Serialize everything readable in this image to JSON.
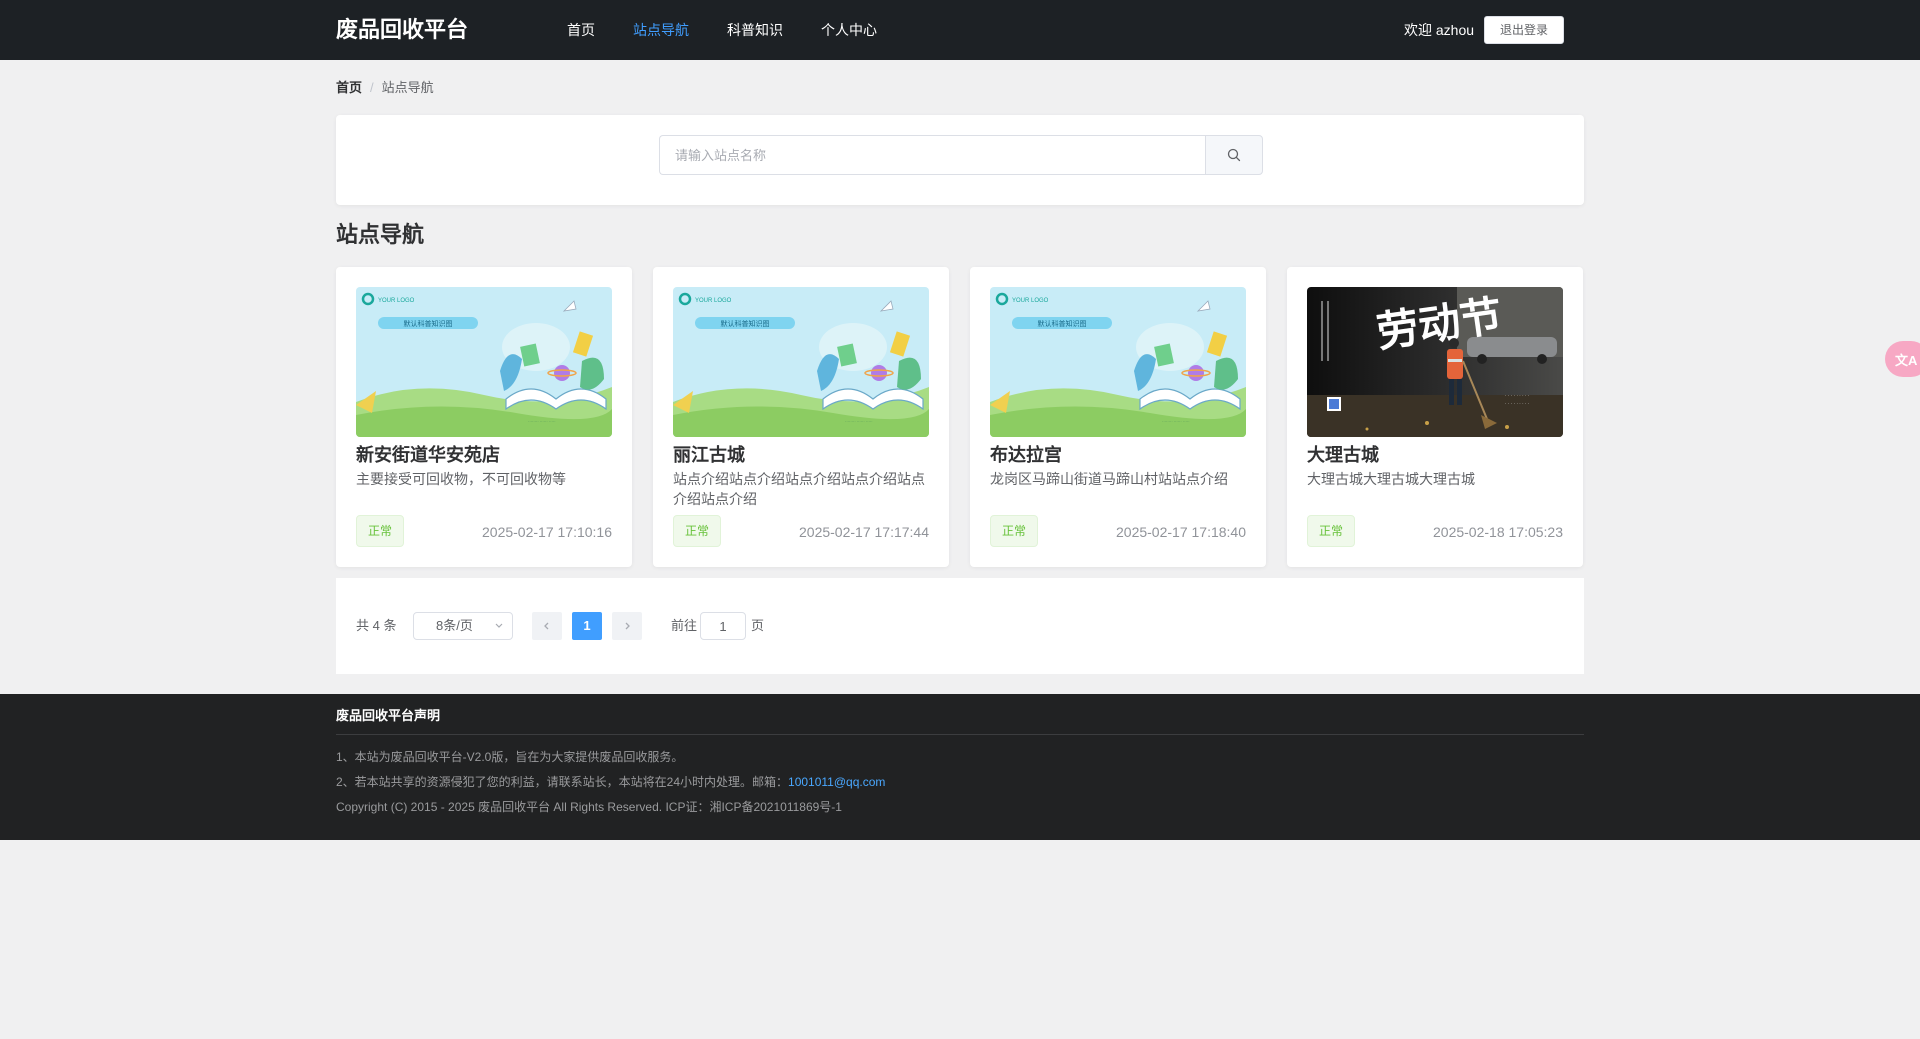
{
  "header": {
    "brand": "废品回收平台",
    "nav": [
      "首页",
      "站点导航",
      "科普知识",
      "个人中心"
    ],
    "welcome": "欢迎 azhou",
    "logout": "退出登录"
  },
  "breadcrumb": {
    "home": "首页",
    "separator": "/",
    "current": "站点导航"
  },
  "search": {
    "placeholder": "请输入站点名称",
    "value": ""
  },
  "section_title": "站点导航",
  "cards": [
    {
      "name": "新安街道华安苑店",
      "desc": "主要接受可回收物，不可回收物等",
      "status": "正常",
      "time": "2025-02-17 17:10:16"
    },
    {
      "name": "丽江古城",
      "desc": "站点介绍站点介绍站点介绍站点介绍站点介绍站点介绍",
      "status": "正常",
      "time": "2025-02-17 17:17:44"
    },
    {
      "name": "布达拉宫",
      "desc": "龙岗区马蹄山街道马蹄山村站站点介绍",
      "status": "正常",
      "time": "2025-02-17 17:18:40"
    },
    {
      "name": "大理古城",
      "desc": "大理古城大理古城大理古城",
      "status": "正常",
      "time": "2025-02-18 17:05:23"
    }
  ],
  "card_image": {
    "logo_text": "YOUR LOGO",
    "banner_text": "默认科普知识图",
    "poster_text": "劳动节"
  },
  "pagination": {
    "total_label": "共 4 条",
    "page_size": "8条/页",
    "current_page": "1",
    "goto_label": "前往",
    "goto_value": "1",
    "page_suffix": "页"
  },
  "footer": {
    "title": "废品回收平台声明",
    "line1": "1、本站为废品回收平台-V2.0版，旨在为大家提供废品回收服务。",
    "line2_prefix": "2、若本站共享的资源侵犯了您的利益，请联系站长，本站将在24小时内处理。邮箱：",
    "email": "1001011@qq.com",
    "copyright": "Copyright (C) 2015 - 2025 废品回收平台 All Rights Reserved. ICP证：湘ICP备2021011869号-1"
  },
  "floating": {
    "label": "文A"
  },
  "colors": {
    "primary": "#409eff",
    "header_bg": "#1d2125",
    "footer_bg": "#212223",
    "success": "#67c23a"
  }
}
